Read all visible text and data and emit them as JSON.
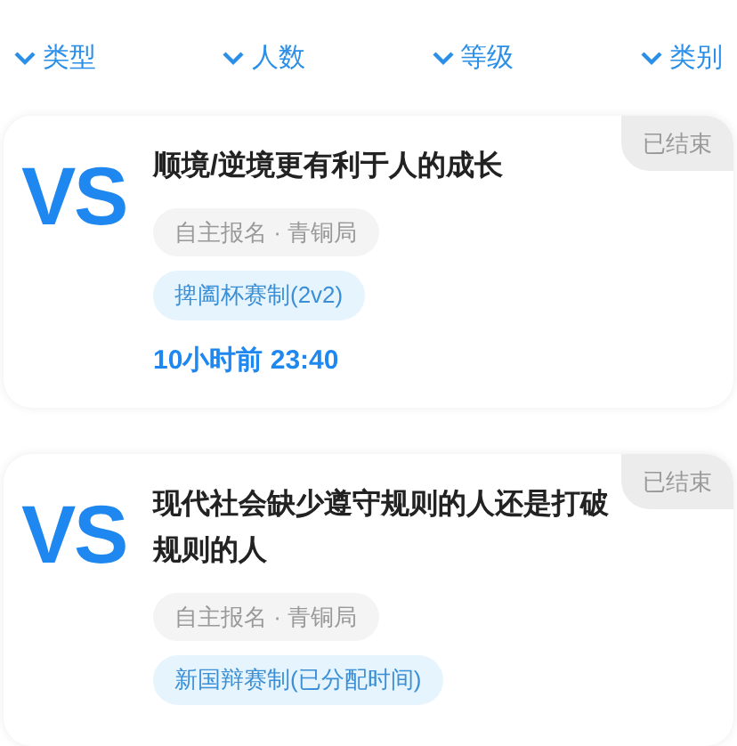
{
  "filters": [
    {
      "label": "类型"
    },
    {
      "label": "人数"
    },
    {
      "label": "等级"
    },
    {
      "label": "类别"
    }
  ],
  "matches": [
    {
      "logo": "VS",
      "title": "顺境/逆境更有利于人的成长",
      "status": "已结束",
      "meta": "自主报名 · 青铜局",
      "format": "捭阖杯赛制(2v2)",
      "time": "10小时前 23:40"
    },
    {
      "logo": "VS",
      "title": "现代社会缺少遵守规则的人还是打破规则的人",
      "status": "已结束",
      "meta": "自主报名 · 青铜局",
      "format": "新国辩赛制(已分配时间)"
    }
  ]
}
